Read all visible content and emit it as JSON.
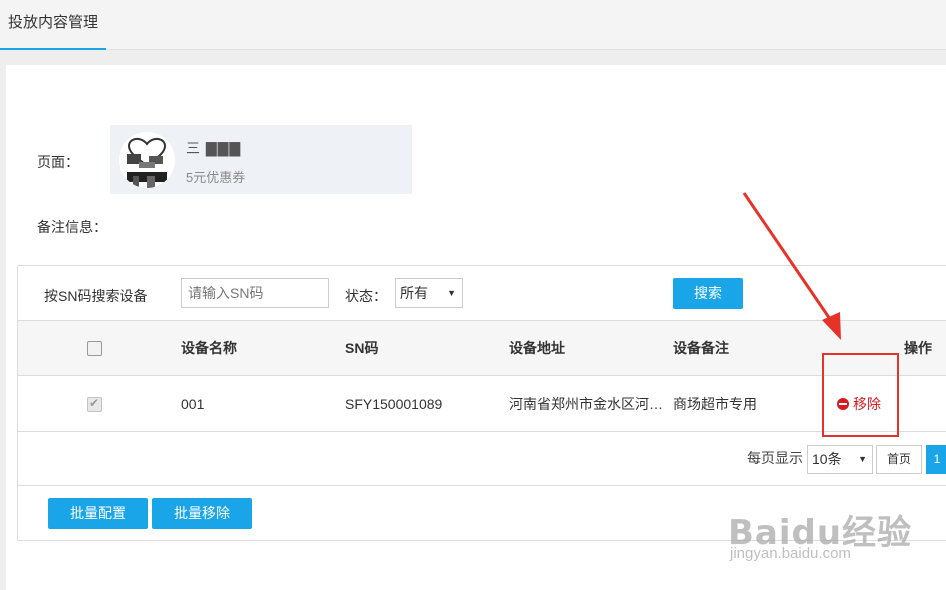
{
  "header": {
    "active_tab": "投放内容管理"
  },
  "form": {
    "page_label": "页面：",
    "page_card": {
      "title": "三  ▇▇▇",
      "subtitle": "5元优惠券"
    },
    "note_label": "备注信息："
  },
  "search": {
    "label": "按SN码搜索设备",
    "placeholder": "请输入SN码",
    "status_label": "状态：",
    "status_value": "所有",
    "button": "搜索"
  },
  "table": {
    "columns": [
      "设备名称",
      "SN码",
      "设备地址",
      "设备备注",
      "操作"
    ],
    "rows": [
      {
        "name": "001",
        "sn": "SFY150001089",
        "address": "河南省郑州市金水区河…",
        "note": "商场超市专用",
        "action": "移除",
        "checked": true
      }
    ]
  },
  "pagination": {
    "per_page_label": "每页显示",
    "per_page_value": "10条",
    "first": "首页",
    "current": "1"
  },
  "footer": {
    "batch_config": "批量配置",
    "batch_remove": "批量移除"
  },
  "watermark": {
    "main": "Baidu经验",
    "sub": "jingyan.baidu.com"
  },
  "colors": {
    "accent": "#1aa5e8",
    "danger": "#d71920",
    "annotation": "#e5332a"
  }
}
